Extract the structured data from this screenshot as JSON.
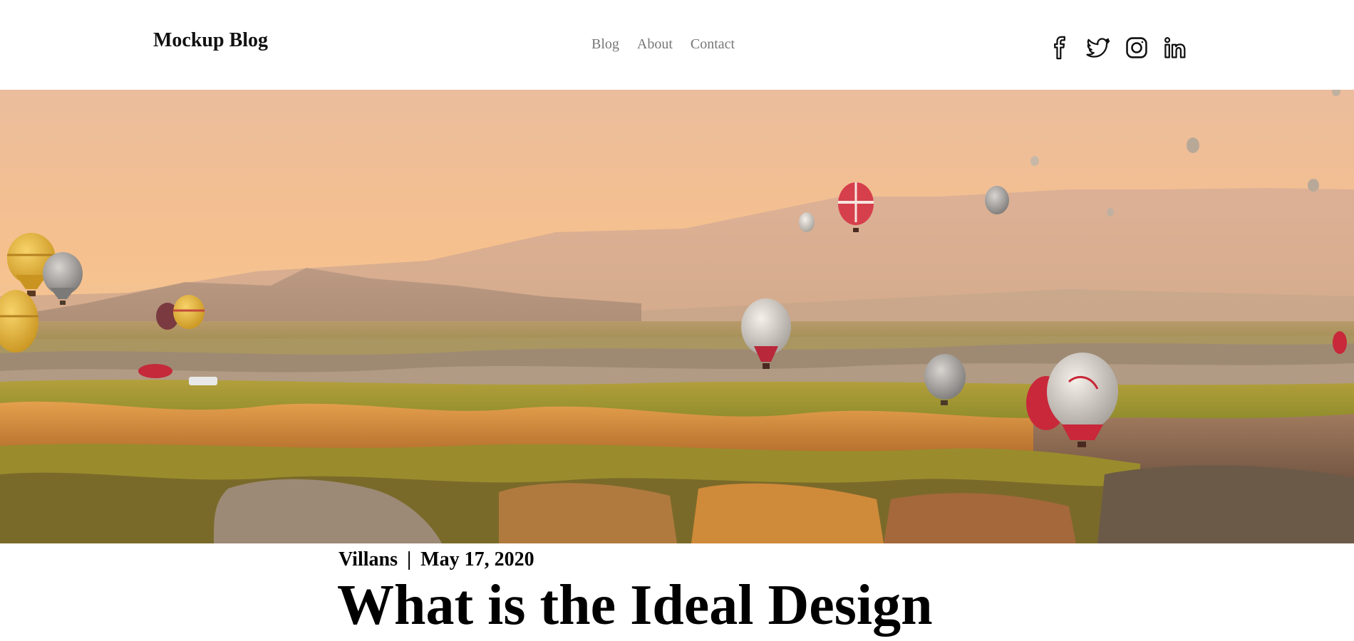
{
  "header": {
    "brand": "Mockup Blog",
    "nav": [
      {
        "label": "Blog"
      },
      {
        "label": "About"
      },
      {
        "label": "Contact"
      }
    ],
    "social": [
      {
        "icon": "facebook-icon"
      },
      {
        "icon": "twitter-icon"
      },
      {
        "icon": "instagram-icon"
      },
      {
        "icon": "linkedin-icon"
      }
    ]
  },
  "hero": {
    "image": "hot-air-balloons-landscape"
  },
  "post": {
    "author": "Villans",
    "separator": "|",
    "date": "May 17, 2020",
    "title": "What is the Ideal Design"
  },
  "colors": {
    "nav_text": "#777777",
    "brand_text": "#111111",
    "sky_top": "#e9b995",
    "sky_bottom": "#f7c383"
  }
}
